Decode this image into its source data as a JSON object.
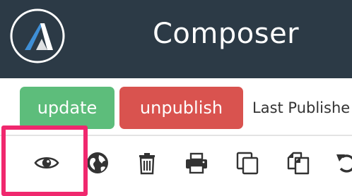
{
  "header": {
    "title": "Composer",
    "logo_icon": "composer-logo-icon",
    "background_color": "#2c3a46"
  },
  "actions": {
    "update_label": "update",
    "update_color": "#5dbd7b",
    "unpublish_label": "unpublish",
    "unpublish_color": "#d9534f",
    "last_published_text": "Last Publishe"
  },
  "toolbar": {
    "tools": [
      {
        "icon": "eye-icon",
        "action": "preview"
      },
      {
        "icon": "globe-icon",
        "action": "view-live"
      },
      {
        "icon": "trash-icon",
        "action": "delete"
      },
      {
        "icon": "printer-icon",
        "action": "print"
      },
      {
        "icon": "copy-icon",
        "action": "duplicate"
      },
      {
        "icon": "paste-icon",
        "action": "paste"
      },
      {
        "icon": "undo-icon",
        "action": "undo"
      }
    ],
    "highlight_color": "#f0286e"
  }
}
